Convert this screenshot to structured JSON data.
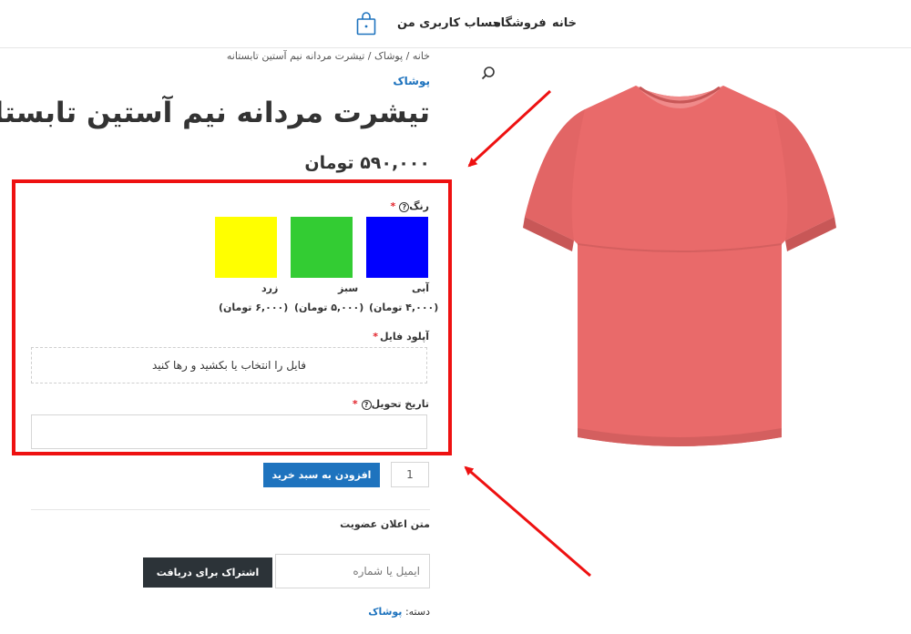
{
  "nav": {
    "home": "خانه",
    "shop": "فروشگاه",
    "account": "حساب کاربری من"
  },
  "icons": {
    "cart": "shopping-bag-icon",
    "search": "search-icon"
  },
  "breadcrumb": {
    "home": "خانه",
    "sep1": " / ",
    "category": "پوشاک",
    "sep2": " / ",
    "current": "تیشرت مردانه نیم آستین تابستانه"
  },
  "product": {
    "category": "پوشاک",
    "title": "تیشرت مردانه نیم آستین تابستانه",
    "price": "۵۹۰,۰۰۰ تومان",
    "image_color": "#e96a6a"
  },
  "options": {
    "color_label": "رنگ",
    "required_mark": "*",
    "help_mark": "?",
    "colors": [
      {
        "name": "آبی",
        "price": "(۴,۰۰۰ تومان)",
        "hex": "#0000ff"
      },
      {
        "name": "سبز",
        "price": "(۵,۰۰۰ تومان)",
        "hex": "#33cc33"
      },
      {
        "name": "زرد",
        "price": "(۶,۰۰۰ تومان)",
        "hex": "#ffff00"
      }
    ],
    "upload_label": "آپلود فایل",
    "upload_placeholder": "فایل را انتخاب یا بکشید و رها کنید",
    "date_label": "تاریخ تحویل",
    "date_value": ""
  },
  "cart": {
    "quantity": "1",
    "add_label": "افزودن به سبد خرید"
  },
  "notify": {
    "text": "متن اعلان عضویت",
    "email_placeholder": "ایمیل یا شماره",
    "subscribe_label": "اشتراک برای دریافت اعلان"
  },
  "meta": {
    "category_label": "دسته:",
    "category_value": "پوشاک"
  },
  "colors": {
    "highlight": "#ee1111",
    "accent": "#1e73be",
    "dark_button": "#2c3338"
  }
}
